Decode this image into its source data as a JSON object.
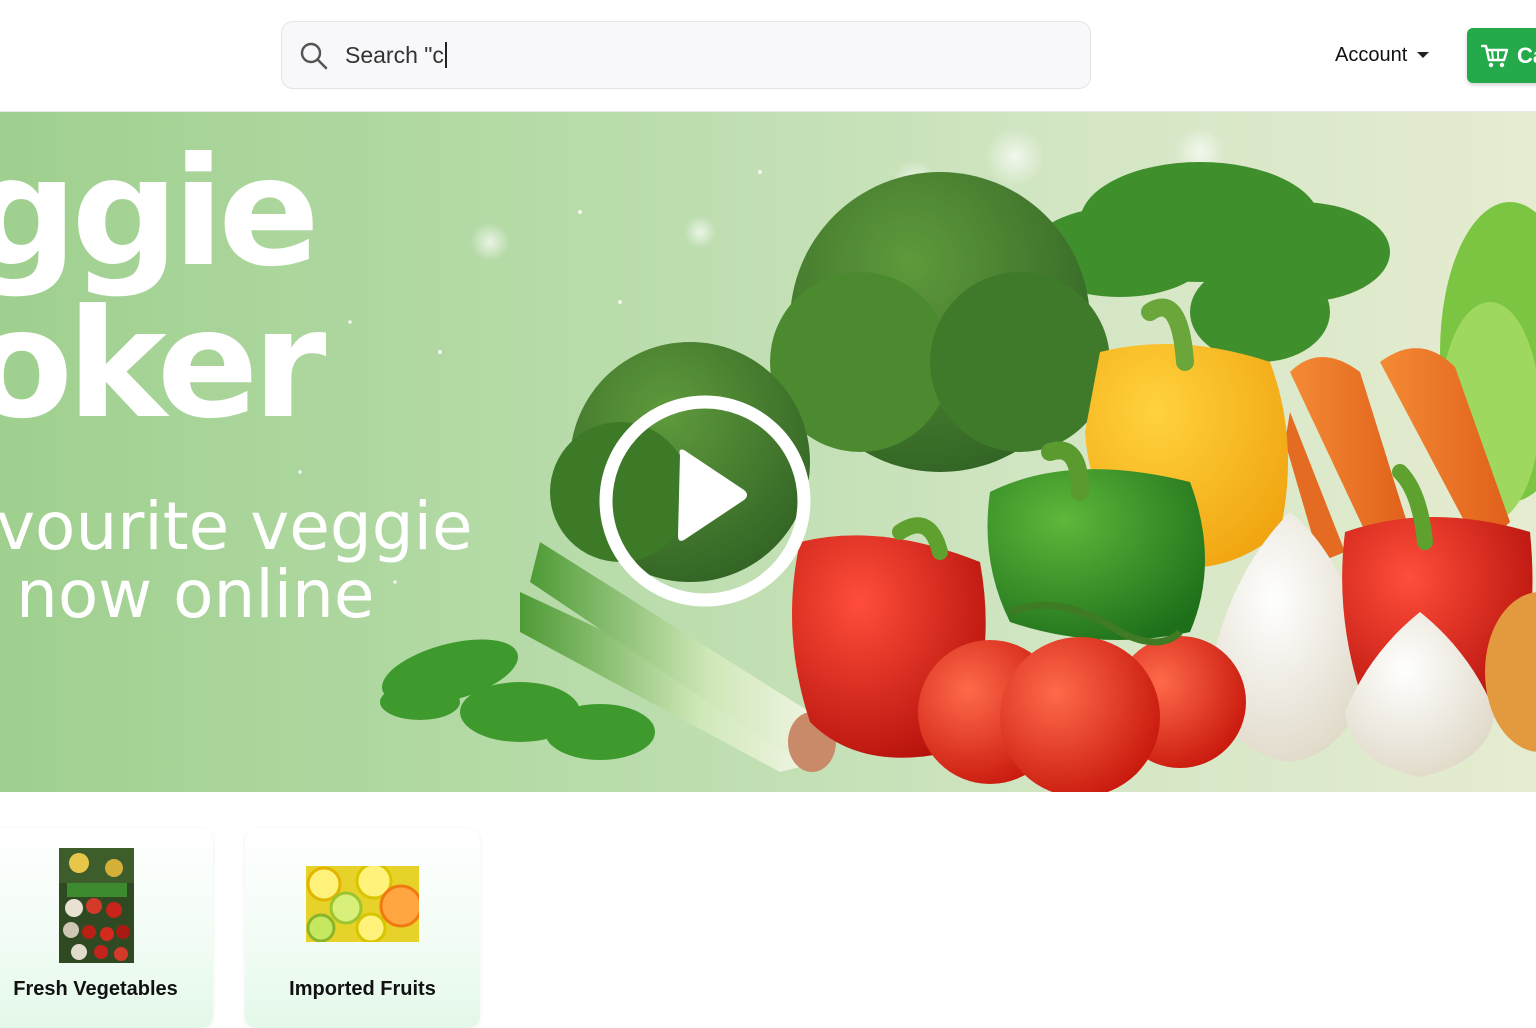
{
  "header": {
    "search": {
      "value": "Search \"c"
    },
    "account_label": "Account",
    "cart_label": "Ca"
  },
  "banner": {
    "title_line1": "ggie",
    "title_line2": "oker",
    "subtitle_line1": "vourite veggie",
    "subtitle_line2": "now online"
  },
  "categories": [
    {
      "label": "Fresh Vegetables",
      "icon": "vegetables-image"
    },
    {
      "label": "Imported Fruits",
      "icon": "citrus-fruits-image"
    }
  ],
  "colors": {
    "accent": "#24a94b",
    "banner_green": "#9fd08f",
    "text": "#111111"
  }
}
